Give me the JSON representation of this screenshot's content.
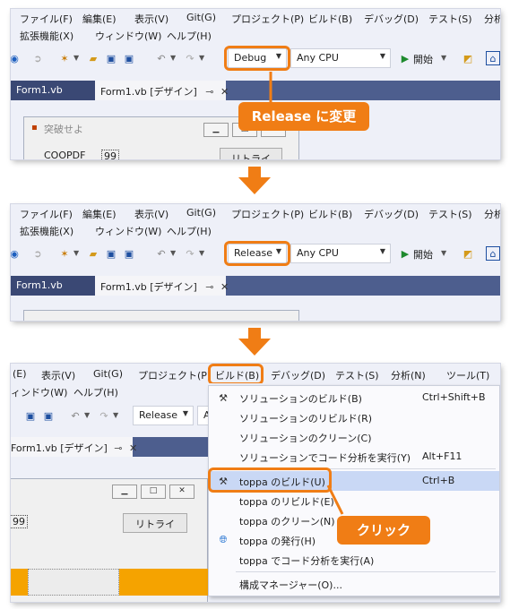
{
  "panel1": {
    "menu_row1": [
      "ファイル(F)",
      "編集(E)",
      "表示(V)",
      "Git(G)",
      "プロジェクト(P)",
      "ビルド(B)",
      "デバッグ(D)",
      "テスト(S)",
      "分析"
    ],
    "menu_row2": [
      "拡張機能(X)",
      "ウィンドウ(W)",
      "ヘルプ(H)"
    ],
    "config": "Debug",
    "platform": "Any CPU",
    "start_label": "開始",
    "tabs": [
      "Form1.vb",
      "Form1.vb [デザイン]"
    ],
    "form_title": "突破せよ",
    "label_text": "COOPDF",
    "label_value": "99",
    "retry_label": "リトライ",
    "callout": "Release に変更"
  },
  "panel2": {
    "menu_row1": [
      "ファイル(F)",
      "編集(E)",
      "表示(V)",
      "Git(G)",
      "プロジェクト(P)",
      "ビルド(B)",
      "デバッグ(D)",
      "テスト(S)",
      "分析"
    ],
    "menu_row2": [
      "拡張機能(X)",
      "ウィンドウ(W)",
      "ヘルプ(H)"
    ],
    "config": "Release",
    "platform": "Any CPU",
    "start_label": "開始",
    "tabs": [
      "Form1.vb",
      "Form1.vb [デザイン]"
    ]
  },
  "panel3": {
    "menu_row1": [
      "(E)",
      "表示(V)",
      "Git(G)",
      "プロジェクト(P)",
      "ビルド(B)",
      "デバッグ(D)",
      "テスト(S)",
      "分析(N)",
      "ツール(T)"
    ],
    "menu_row2": [
      "ィンドウ(W)",
      "ヘルプ(H)"
    ],
    "config": "Release",
    "platform_partial": "A",
    "tab": "Form1.vb [デザイン]",
    "label_value": "99",
    "retry_label": "リトライ",
    "callout": "クリック",
    "build_menu": {
      "items": [
        {
          "label": "ソリューションのビルド(B)",
          "shortcut": "Ctrl+Shift+B",
          "icon": "build-solution-icon"
        },
        {
          "label": "ソリューションのリビルド(R)",
          "shortcut": "",
          "icon": ""
        },
        {
          "label": "ソリューションのクリーン(C)",
          "shortcut": "",
          "icon": ""
        },
        {
          "label": "ソリューションでコード分析を実行(Y)",
          "shortcut": "Alt+F11",
          "icon": ""
        },
        {
          "label": "toppa のビルド(U)",
          "shortcut": "Ctrl+B",
          "icon": "build-project-icon"
        },
        {
          "label": "toppa のリビルド(E)",
          "shortcut": "",
          "icon": ""
        },
        {
          "label": "toppa のクリーン(N)",
          "shortcut": "",
          "icon": ""
        },
        {
          "label": "toppa の発行(H)",
          "shortcut": "",
          "icon": "globe-icon"
        },
        {
          "label": "toppa でコード分析を実行(A)",
          "shortcut": "",
          "icon": ""
        },
        {
          "label": "構成マネージャー(O)...",
          "shortcut": "",
          "icon": ""
        }
      ]
    }
  },
  "colors": {
    "accent": "#f07d15",
    "menu_highlight": "#c9d8f5",
    "tab_strip": "#4d5e8e",
    "form_orange": "#f5a300"
  }
}
